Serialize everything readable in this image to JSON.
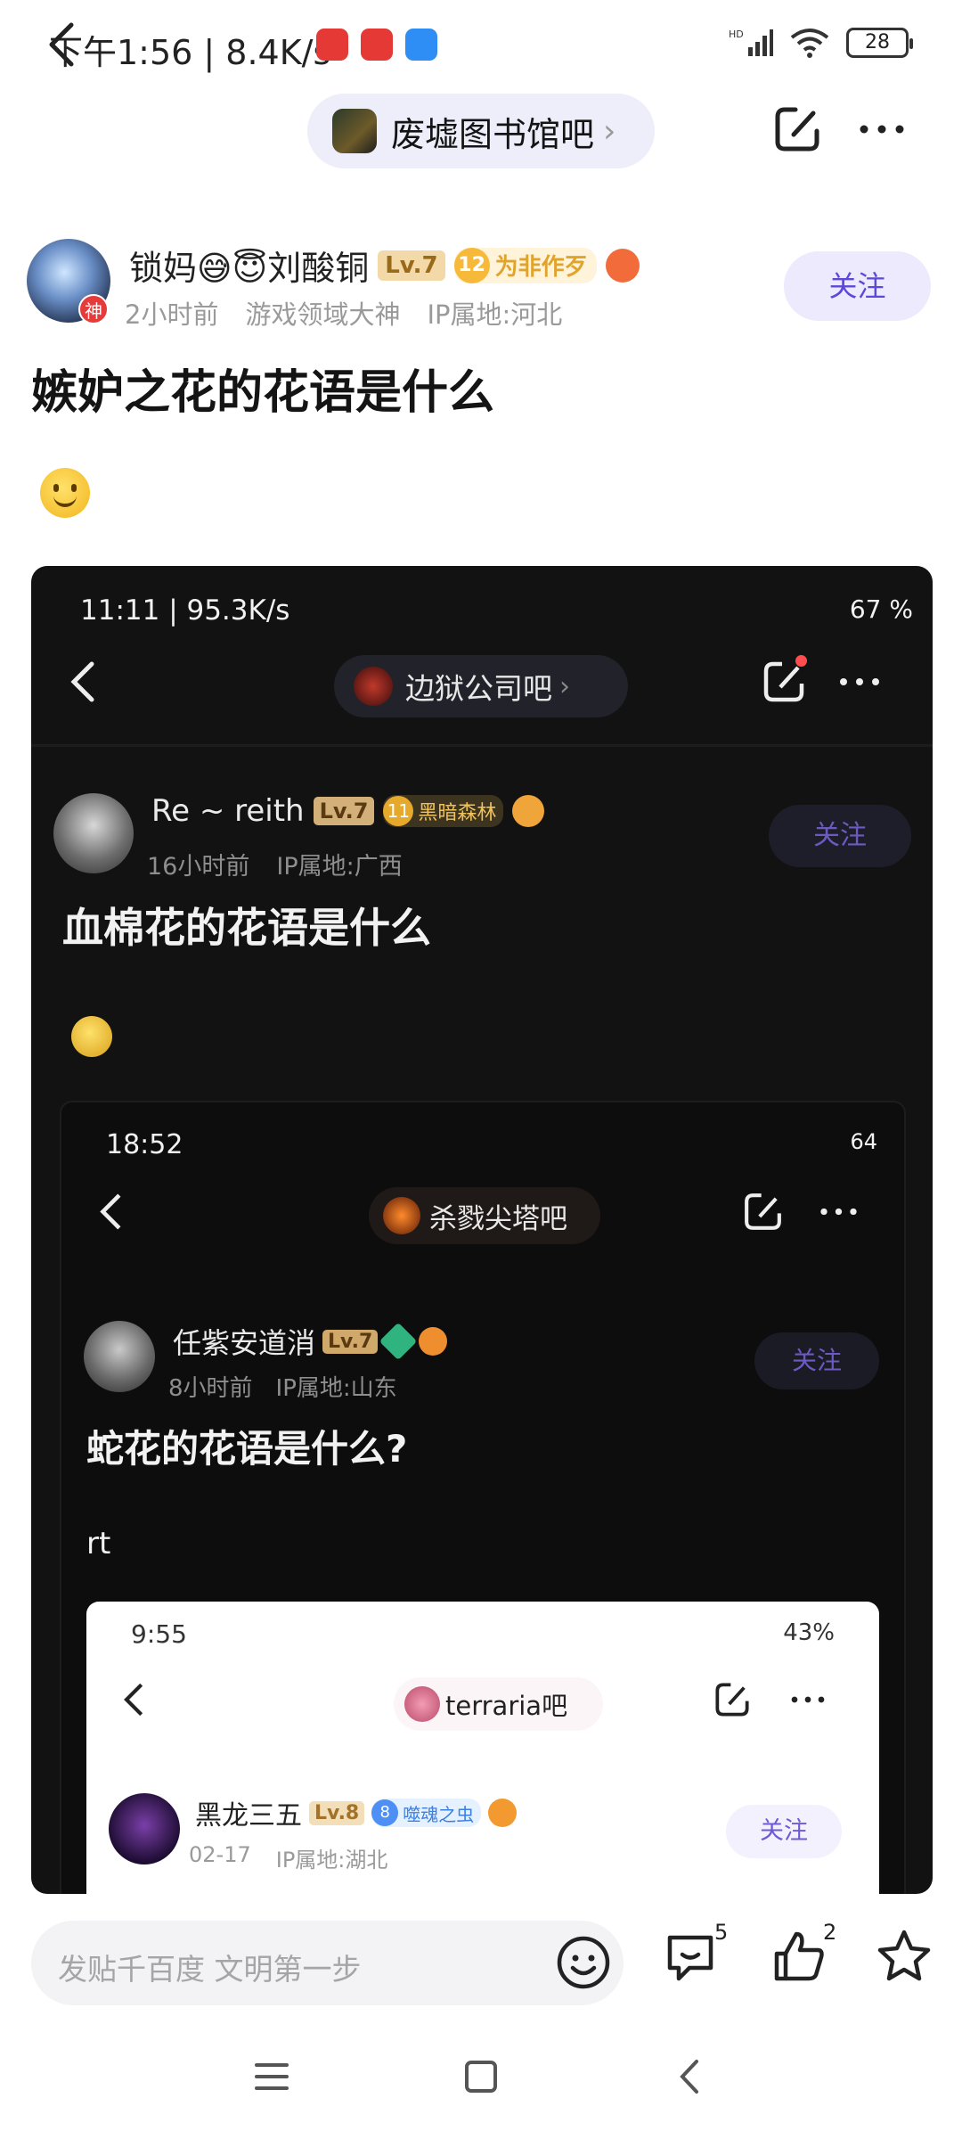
{
  "status_bar": {
    "time_speed": "下午1:56 | 8.4K/s",
    "battery": "28"
  },
  "nav": {
    "forum_name": "废墟图书馆吧"
  },
  "author": {
    "name": "锁妈😅😇刘酸铜",
    "level": "Lv.7",
    "fan_level": "12",
    "fan_title": "为非作歹",
    "god_badge": "神",
    "time": "2小时前",
    "honor": "游戏领域大神",
    "ip": "IP属地:河北",
    "follow_label": "关注"
  },
  "post": {
    "title": "嫉妒之花的花语是什么"
  },
  "embedded1": {
    "time_speed": "11:11 | 95.3K/s",
    "battery": "67 %",
    "forum_name": "边狱公司吧",
    "author_name": "Re ~ reith",
    "level": "Lv.7",
    "fan_level": "11",
    "fan_title": "黑暗森林",
    "time": "16小时前",
    "ip": "IP属地:广西",
    "follow_label": "关注",
    "title": "血棉花的花语是什么"
  },
  "embedded2": {
    "time": "18:52",
    "battery": "64",
    "forum_name": "杀戮尖塔吧",
    "author_name": "任紫安道消",
    "level": "Lv.7",
    "post_time": "8小时前",
    "ip": "IP属地:山东",
    "follow_label": "关注",
    "title": "蛇花的花语是什么?",
    "body": "rt"
  },
  "embedded3": {
    "time": "9:55",
    "battery": "43%",
    "forum_name": "terraria吧",
    "author_name": "黑龙三五",
    "level": "Lv.8",
    "fan_level": "8",
    "fan_title": "噬魂之虫",
    "date": "02-17",
    "ip": "IP属地:湖北",
    "follow_label": "关注"
  },
  "bottom": {
    "reply_placeholder": "发贴千百度 文明第一步",
    "comment_count": "5",
    "like_count": "2"
  },
  "colors": {
    "accent": "#5c48d9",
    "follow_bg": "#eceafc"
  }
}
